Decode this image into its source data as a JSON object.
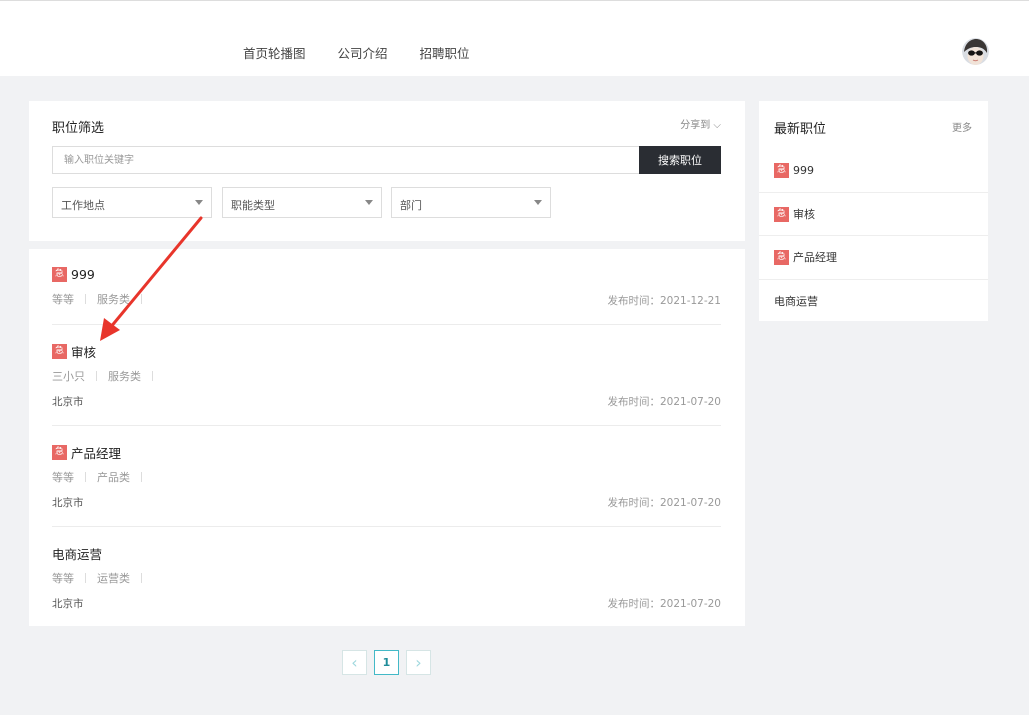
{
  "nav": {
    "items": [
      "首页轮播图",
      "公司介绍",
      "招聘职位"
    ]
  },
  "filter": {
    "title": "职位筛选",
    "share_label": "分享到 ⌵",
    "search_placeholder": "输入职位关键字",
    "search_button": "搜索职位",
    "selects": [
      "工作地点",
      "职能类型",
      "部门"
    ]
  },
  "jobs": [
    {
      "urgent": "急",
      "title": "999",
      "meta": [
        "等等",
        "服务类"
      ],
      "city": "",
      "date": "发布时间：2021-12-21"
    },
    {
      "urgent": "急",
      "title": "审核",
      "meta": [
        "三小只",
        "服务类"
      ],
      "city": "北京市",
      "date": "发布时间：2021-07-20"
    },
    {
      "urgent": "急",
      "title": "产品经理",
      "meta": [
        "等等",
        "产品类"
      ],
      "city": "北京市",
      "date": "发布时间：2021-07-20"
    },
    {
      "urgent": "",
      "title": "电商运营",
      "meta": [
        "等等",
        "运营类"
      ],
      "city": "北京市",
      "date": "发布时间：2021-07-20"
    }
  ],
  "latest": {
    "title": "最新职位",
    "more": "更多",
    "items": [
      {
        "urgent": "急",
        "title": "999"
      },
      {
        "urgent": "急",
        "title": "审核"
      },
      {
        "urgent": "急",
        "title": "产品经理"
      },
      {
        "urgent": "",
        "title": "电商运营"
      }
    ]
  },
  "pagination": {
    "prev": "‹",
    "current": "1",
    "next": "›"
  },
  "colors": {
    "urgent_tag": "#e86864",
    "search_button": "#2a2d33",
    "pager_active": "#43b9c7",
    "annotation_arrow": "#e8352b"
  }
}
